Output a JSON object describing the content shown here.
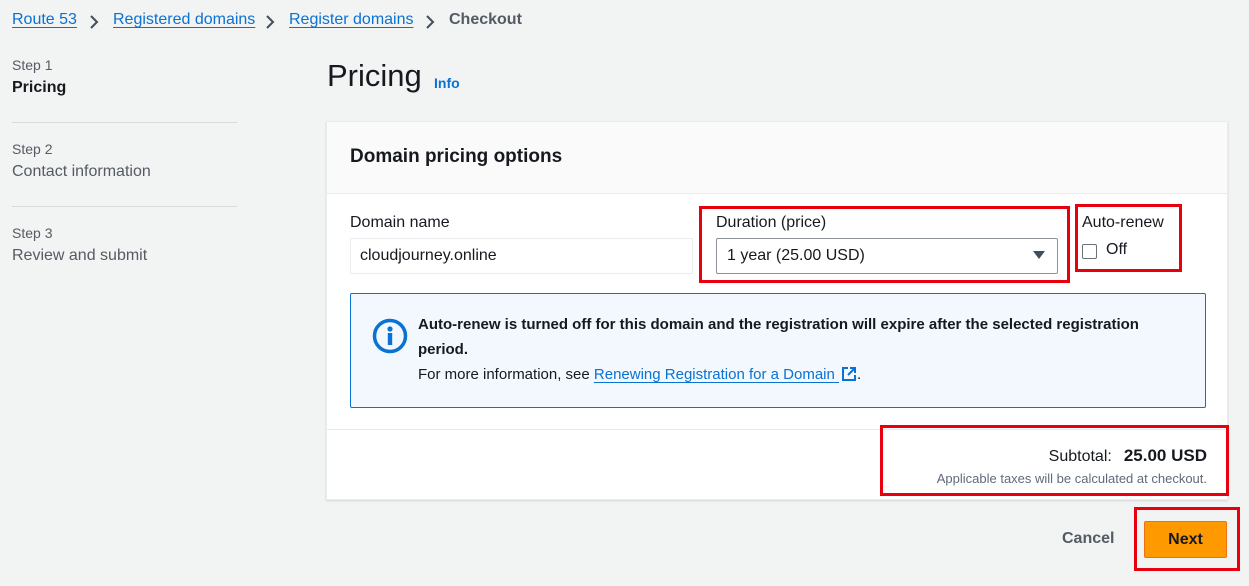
{
  "breadcrumbs": {
    "items": [
      {
        "label": "Route 53"
      },
      {
        "label": "Registered domains"
      },
      {
        "label": "Register domains"
      }
    ],
    "current": "Checkout"
  },
  "steps": [
    {
      "number": "Step 1",
      "title": "Pricing"
    },
    {
      "number": "Step 2",
      "title": "Contact information"
    },
    {
      "number": "Step 3",
      "title": "Review and submit"
    }
  ],
  "page": {
    "title": "Pricing",
    "info_link": "Info"
  },
  "pricing_card": {
    "title": "Domain pricing options",
    "domain_name": {
      "label": "Domain name",
      "value": "cloudjourney.online"
    },
    "duration": {
      "label": "Duration (price)",
      "selected": "1 year (25.00 USD)"
    },
    "auto_renew": {
      "label": "Auto-renew",
      "state_label": "Off",
      "checked": false
    },
    "alert": {
      "message_bold": "Auto-renew is turned off for this domain and the registration will expire after the selected registration period.",
      "more_info_prefix": "For more information, see",
      "link_text": "Renewing Registration for a Domain",
      "suffix": "."
    },
    "subtotal": {
      "label": "Subtotal:",
      "value": "25.00 USD",
      "note": "Applicable taxes will be calculated at checkout."
    }
  },
  "actions": {
    "cancel_label": "Cancel",
    "next_label": "Next"
  },
  "colors": {
    "link": "#0972d3",
    "primary_button": "#ff9900",
    "highlight_box": "#e8000f",
    "info_icon": "#0972d3"
  },
  "icons": {
    "breadcrumb_separator": "chevron-right-icon",
    "alert": "info-circle-icon",
    "external_link": "external-link-icon",
    "dropdown": "caret-down-icon"
  }
}
